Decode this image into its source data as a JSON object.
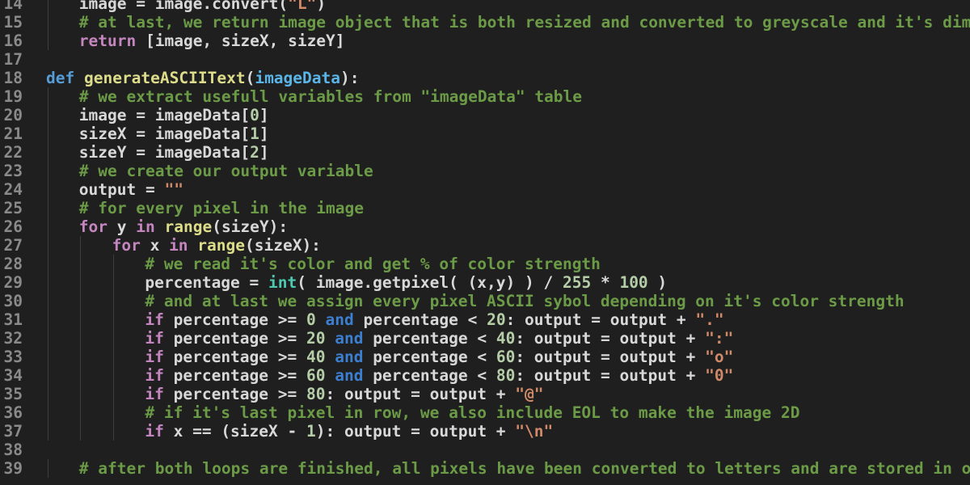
{
  "editor": {
    "theme": {
      "background": "#1f1f1f",
      "line_number": "#8a8a8a",
      "comment": "#6c9b47",
      "keyword": "#c586c0",
      "def": "#569cd6",
      "and": "#3c7ed0",
      "function": "#dcdc8b",
      "param": "#5ab4e6",
      "string": "#d08a6a",
      "number": "#b5cea8",
      "builtin": "#4ec9b0",
      "plain": "#d8d8d8"
    },
    "lines": [
      {
        "num": "14",
        "indent": 1,
        "tokens": [
          [
            "plain",
            "image = image.convert("
          ],
          [
            "string",
            "\"L\""
          ],
          [
            "plain",
            ")"
          ]
        ]
      },
      {
        "num": "15",
        "indent": 1,
        "tokens": [
          [
            "comment",
            "# at last, we return image object that is both resized and converted to greyscale and it's dimensions"
          ]
        ]
      },
      {
        "num": "16",
        "indent": 1,
        "tokens": [
          [
            "keyword",
            "return"
          ],
          [
            "plain",
            " [image, sizeX, sizeY]"
          ]
        ]
      },
      {
        "num": "17",
        "indent": 0,
        "tokens": []
      },
      {
        "num": "18",
        "indent": 0,
        "tokens": [
          [
            "def",
            "def"
          ],
          [
            "plain",
            " "
          ],
          [
            "func",
            "generateASCIIText"
          ],
          [
            "plain",
            "("
          ],
          [
            "param",
            "imageData"
          ],
          [
            "plain",
            "):"
          ]
        ]
      },
      {
        "num": "19",
        "indent": 1,
        "tokens": [
          [
            "comment",
            "# we extract usefull variables from \"imageData\" table"
          ]
        ]
      },
      {
        "num": "20",
        "indent": 1,
        "tokens": [
          [
            "plain",
            "image = imageData["
          ],
          [
            "number",
            "0"
          ],
          [
            "plain",
            "]"
          ]
        ]
      },
      {
        "num": "21",
        "indent": 1,
        "tokens": [
          [
            "plain",
            "sizeX = imageData["
          ],
          [
            "number",
            "1"
          ],
          [
            "plain",
            "]"
          ]
        ]
      },
      {
        "num": "22",
        "indent": 1,
        "tokens": [
          [
            "plain",
            "sizeY = imageData["
          ],
          [
            "number",
            "2"
          ],
          [
            "plain",
            "]"
          ]
        ]
      },
      {
        "num": "23",
        "indent": 1,
        "tokens": [
          [
            "comment",
            "# we create our output variable"
          ]
        ]
      },
      {
        "num": "24",
        "indent": 1,
        "tokens": [
          [
            "plain",
            "output = "
          ],
          [
            "string",
            "\"\""
          ]
        ]
      },
      {
        "num": "25",
        "indent": 1,
        "tokens": [
          [
            "comment",
            "# for every pixel in the image"
          ]
        ]
      },
      {
        "num": "26",
        "indent": 1,
        "tokens": [
          [
            "keyword",
            "for"
          ],
          [
            "plain",
            " y "
          ],
          [
            "keyword",
            "in"
          ],
          [
            "plain",
            " "
          ],
          [
            "func",
            "range"
          ],
          [
            "plain",
            "(sizeY):"
          ]
        ]
      },
      {
        "num": "27",
        "indent": 2,
        "tokens": [
          [
            "keyword",
            "for"
          ],
          [
            "plain",
            " x "
          ],
          [
            "keyword",
            "in"
          ],
          [
            "plain",
            " "
          ],
          [
            "func",
            "range"
          ],
          [
            "plain",
            "(sizeX):"
          ]
        ]
      },
      {
        "num": "28",
        "indent": 3,
        "tokens": [
          [
            "comment",
            "# we read it's color and get % of color strength"
          ]
        ]
      },
      {
        "num": "29",
        "indent": 3,
        "tokens": [
          [
            "plain",
            "percentage = "
          ],
          [
            "builtin",
            "int"
          ],
          [
            "plain",
            "( image.getpixel( (x,y) ) / "
          ],
          [
            "number",
            "255"
          ],
          [
            "plain",
            " * "
          ],
          [
            "number",
            "100"
          ],
          [
            "plain",
            " )"
          ]
        ]
      },
      {
        "num": "30",
        "indent": 3,
        "tokens": [
          [
            "comment",
            "# and at last we assign every pixel ASCII sybol depending on it's color strength"
          ]
        ]
      },
      {
        "num": "31",
        "indent": 3,
        "tokens": [
          [
            "keyword",
            "if"
          ],
          [
            "plain",
            " percentage >= "
          ],
          [
            "number",
            "0"
          ],
          [
            "plain",
            " "
          ],
          [
            "and",
            "and"
          ],
          [
            "plain",
            " percentage < "
          ],
          [
            "number",
            "20"
          ],
          [
            "plain",
            ": output = output + "
          ],
          [
            "string",
            "\".\""
          ]
        ]
      },
      {
        "num": "32",
        "indent": 3,
        "tokens": [
          [
            "keyword",
            "if"
          ],
          [
            "plain",
            " percentage >= "
          ],
          [
            "number",
            "20"
          ],
          [
            "plain",
            " "
          ],
          [
            "and",
            "and"
          ],
          [
            "plain",
            " percentage < "
          ],
          [
            "number",
            "40"
          ],
          [
            "plain",
            ": output = output + "
          ],
          [
            "string",
            "\":\""
          ]
        ]
      },
      {
        "num": "33",
        "indent": 3,
        "tokens": [
          [
            "keyword",
            "if"
          ],
          [
            "plain",
            " percentage >= "
          ],
          [
            "number",
            "40"
          ],
          [
            "plain",
            " "
          ],
          [
            "and",
            "and"
          ],
          [
            "plain",
            " percentage < "
          ],
          [
            "number",
            "60"
          ],
          [
            "plain",
            ": output = output + "
          ],
          [
            "string",
            "\"o\""
          ]
        ]
      },
      {
        "num": "34",
        "indent": 3,
        "tokens": [
          [
            "keyword",
            "if"
          ],
          [
            "plain",
            " percentage >= "
          ],
          [
            "number",
            "60"
          ],
          [
            "plain",
            " "
          ],
          [
            "and",
            "and"
          ],
          [
            "plain",
            " percentage < "
          ],
          [
            "number",
            "80"
          ],
          [
            "plain",
            ": output = output + "
          ],
          [
            "string",
            "\"0\""
          ]
        ]
      },
      {
        "num": "35",
        "indent": 3,
        "tokens": [
          [
            "keyword",
            "if"
          ],
          [
            "plain",
            " percentage >= "
          ],
          [
            "number",
            "80"
          ],
          [
            "plain",
            ": output = output + "
          ],
          [
            "string",
            "\"@\""
          ]
        ]
      },
      {
        "num": "36",
        "indent": 3,
        "tokens": [
          [
            "comment",
            "# if it's last pixel in row, we also include EOL to make the image 2D"
          ]
        ]
      },
      {
        "num": "37",
        "indent": 3,
        "tokens": [
          [
            "keyword",
            "if"
          ],
          [
            "plain",
            " x == (sizeX - "
          ],
          [
            "number",
            "1"
          ],
          [
            "plain",
            "): output = output + "
          ],
          [
            "string",
            "\"\\n\""
          ]
        ]
      },
      {
        "num": "38",
        "indent": 0,
        "tokens": []
      },
      {
        "num": "39",
        "indent": 1,
        "tokens": [
          [
            "comment",
            "# after both loops are finished, all pixels have been converted to letters and are stored in our \"output\" var"
          ]
        ]
      }
    ]
  }
}
